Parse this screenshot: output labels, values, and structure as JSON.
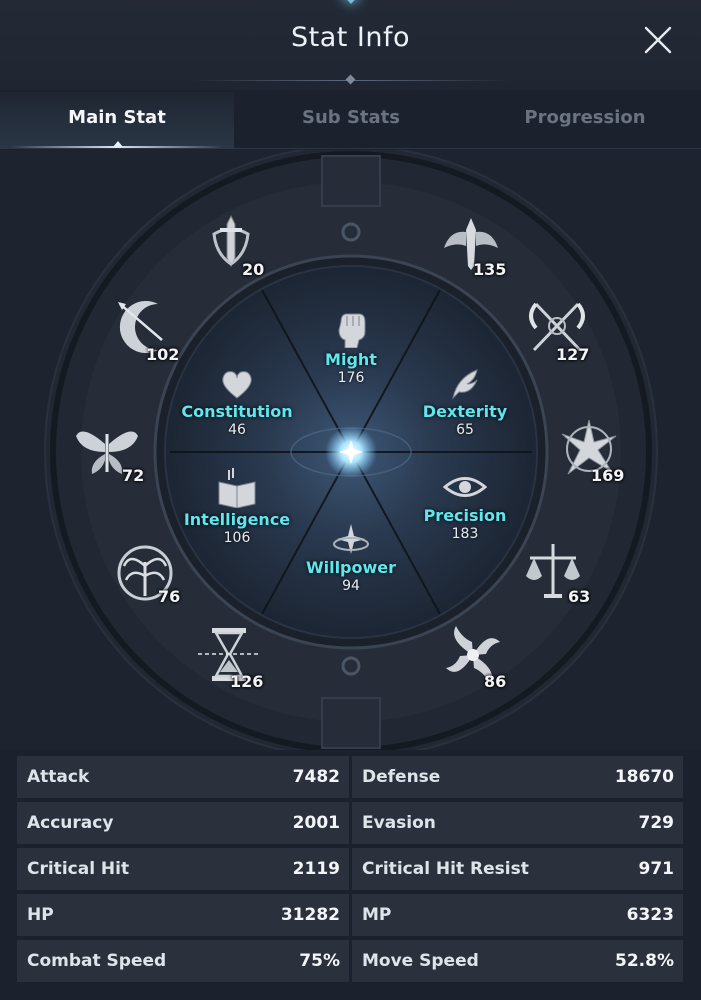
{
  "title": "Stat Info",
  "tabs": [
    {
      "label": "Main Stat"
    },
    {
      "label": "Sub Stats"
    },
    {
      "label": "Progression"
    }
  ],
  "main_stats": {
    "might": {
      "label": "Might",
      "value": "176"
    },
    "constitution": {
      "label": "Constitution",
      "value": "46"
    },
    "dexterity": {
      "label": "Dexterity",
      "value": "65"
    },
    "intelligence": {
      "label": "Intelligence",
      "value": "106"
    },
    "precision": {
      "label": "Precision",
      "value": "183"
    },
    "willpower": {
      "label": "Willpower",
      "value": "94"
    }
  },
  "outer_stats": [
    {
      "icon": "sword-shield-icon",
      "value": "20"
    },
    {
      "icon": "winged-blade-icon",
      "value": "135"
    },
    {
      "icon": "bow-crescent-icon",
      "value": "102"
    },
    {
      "icon": "crossed-scythes-icon",
      "value": "127"
    },
    {
      "icon": "butterfly-icon",
      "value": "72"
    },
    {
      "icon": "star-compass-icon",
      "value": "169"
    },
    {
      "icon": "tree-crest-icon",
      "value": "76"
    },
    {
      "icon": "scales-icon",
      "value": "63"
    },
    {
      "icon": "hourglass-icon",
      "value": "126"
    },
    {
      "icon": "swirl-flame-icon",
      "value": "86"
    }
  ],
  "stats": [
    {
      "left": {
        "name": "Attack",
        "value": "7482"
      },
      "right": {
        "name": "Defense",
        "value": "18670"
      }
    },
    {
      "left": {
        "name": "Accuracy",
        "value": "2001"
      },
      "right": {
        "name": "Evasion",
        "value": "729"
      }
    },
    {
      "left": {
        "name": "Critical Hit",
        "value": "2119"
      },
      "right": {
        "name": "Critical Hit Resist",
        "value": "971"
      }
    },
    {
      "left": {
        "name": "HP",
        "value": "31282"
      },
      "right": {
        "name": "MP",
        "value": "6323"
      }
    },
    {
      "left": {
        "name": "Combat Speed",
        "value": "75%"
      },
      "right": {
        "name": "Move Speed",
        "value": "52.8%"
      }
    }
  ],
  "colors": {
    "accent": "#5fe6ee",
    "background": "#1c222d",
    "row": "#2b313c"
  }
}
